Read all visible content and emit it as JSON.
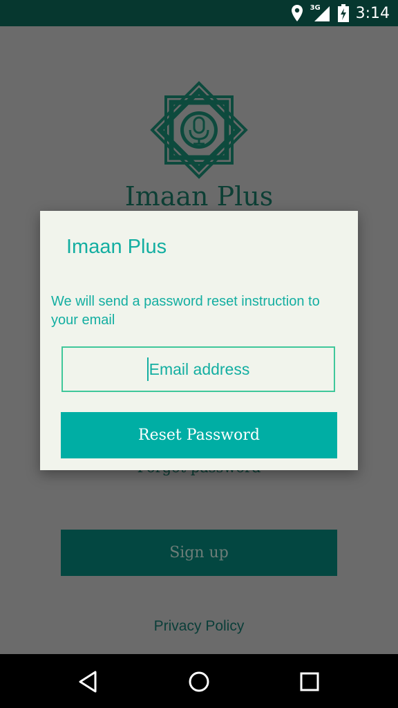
{
  "status_bar": {
    "network_label": "3G",
    "time": "3:14",
    "icons": [
      "location-icon",
      "signal-icon",
      "battery-icon"
    ]
  },
  "background": {
    "logo_text": "Imaan Plus",
    "forgot_password": "Forgot password",
    "signup_label": "Sign up",
    "privacy_label": "Privacy Policy"
  },
  "dialog": {
    "title": "Imaan Plus",
    "message": "We will send a password reset instruction to your email",
    "email_placeholder": "Email address",
    "email_value": "",
    "reset_label": "Reset Password"
  },
  "nav_bar": {
    "icons": [
      "back-icon",
      "home-icon",
      "recents-icon"
    ]
  },
  "colors": {
    "accent": "#00aea4",
    "status_bar": "#06372f",
    "dialog_bg": "#f1f4ec",
    "field_border": "#3fc79a"
  }
}
